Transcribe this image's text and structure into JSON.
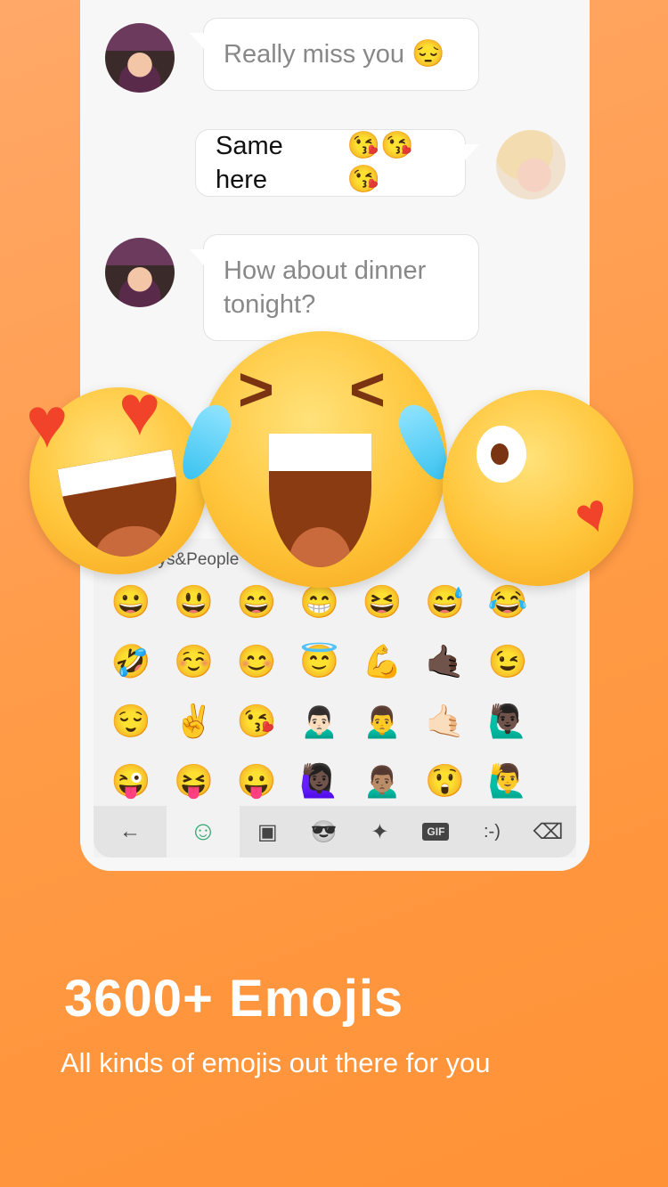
{
  "chat": {
    "messages": [
      {
        "sender": "friend",
        "avatar": "man-with-beard",
        "text": "Really miss you",
        "emoji": "😔"
      },
      {
        "sender": "self",
        "avatar": "woman-with-hat",
        "text": "Same here",
        "emoji": "😘😘😘"
      },
      {
        "sender": "friend",
        "avatar": "man-with-beard",
        "text": "How about dinner tonight?",
        "emoji": ""
      }
    ]
  },
  "stickers": [
    "heart-eyes-laughing-emoji",
    "tears-of-joy-emoji",
    "kissing-wink-emoji"
  ],
  "keyboard": {
    "category_label": "Smileys&People",
    "emoji_rows": [
      [
        "😀",
        "😃",
        "😄",
        "😁",
        "😆",
        "😅",
        "😂"
      ],
      [
        "🤣",
        "☺️",
        "😊",
        "😇",
        "💪",
        "🤙🏿",
        "😉"
      ],
      [
        "😌",
        "✌️",
        "😘",
        "🙍🏻‍♂️",
        "🙍‍♂️",
        "🤙🏻",
        "🙋🏿‍♂️"
      ],
      [
        "😜",
        "😝",
        "😛",
        "🙋🏿‍♀️",
        "🙍🏽‍♂️",
        "😲",
        "🙋‍♂️"
      ]
    ],
    "toolbar": {
      "back": "←",
      "emoji": "☺",
      "sticker": "▣",
      "cool": "😎",
      "sparkle": "✦",
      "gif": "GIF",
      "emoticon": ":-)",
      "delete": "⌫"
    },
    "accent_color": "#3aa876"
  },
  "promo": {
    "headline": "3600+ Emojis",
    "subtitle": "All kinds of emojis out there for you"
  }
}
